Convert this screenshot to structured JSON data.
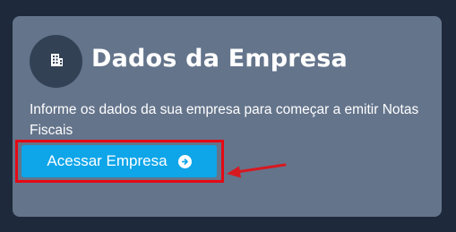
{
  "card": {
    "icon": "building-icon",
    "title": "Dados da Empresa",
    "description": "Informe os dados da sua empresa para começar a emitir Notas Fiscais",
    "button": {
      "label": "Acessar Empresa",
      "icon": "arrow-circle-right-icon"
    }
  },
  "annotation": {
    "highlight_color": "#e50914",
    "arrow_color": "#d71920"
  },
  "colors": {
    "page_bg": "#1e293b",
    "card_bg": "#64748b",
    "icon_circle_bg": "#334155",
    "button_bg": "#0ea5e9"
  }
}
